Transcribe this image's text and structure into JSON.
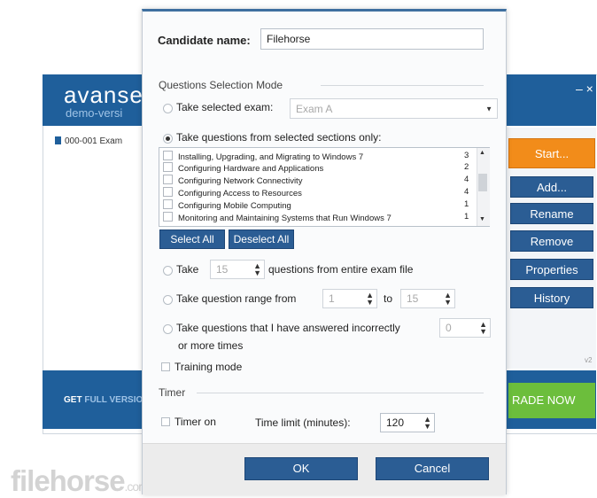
{
  "background_app": {
    "logo_text": "avanse",
    "logo_subtext": "demo-versi",
    "minimize_glyph": "– ×",
    "exam_list": [
      "000-001 Exam"
    ],
    "footer_text_a": "GET ",
    "footer_text_b": "FULL VERSIO",
    "side_buttons": {
      "start": "Start...",
      "add": "Add...",
      "rename": "Rename",
      "remove": "Remove",
      "properties": "Properties",
      "history": "History"
    },
    "upgrade_button": "RADE NOW",
    "version_hint": "v2",
    "accent_colors": {
      "banner": "#1f5f9b",
      "start": "#f28c1a",
      "upgrade": "#6cbe3c",
      "button": "#2b5d94"
    }
  },
  "watermark": {
    "text": "filehorse",
    "suffix": ".com"
  },
  "dialog": {
    "candidate_label": "Candidate name:",
    "candidate_value": "Filehorse",
    "questions_mode_title": "Questions Selection Mode",
    "opt_selected_exam": "Take selected exam:",
    "selected_exam_value": "Exam A",
    "opt_sections": "Take questions from selected sections only:",
    "sections": [
      {
        "name": "Installing, Upgrading, and Migrating to Windows 7",
        "count": "3"
      },
      {
        "name": "Configuring Hardware and Applications",
        "count": "2"
      },
      {
        "name": "Configuring Network Connectivity",
        "count": "4"
      },
      {
        "name": "Configuring Access to Resources",
        "count": "4"
      },
      {
        "name": "Configuring Mobile Computing",
        "count": "1"
      },
      {
        "name": "Monitoring and Maintaining Systems that Run Windows 7",
        "count": "1"
      }
    ],
    "select_all": "Select All",
    "deselect_all": "Deselect All",
    "opt_take": "Take",
    "take_value": "15",
    "take_suffix": "questions from entire exam file",
    "opt_range": "Take question range from",
    "range_from": "1",
    "range_to_label": "to",
    "range_to": "15",
    "opt_incorrect": "Take questions that I have answered incorrectly",
    "incorrect_value": "0",
    "incorrect_suffix": "or more times",
    "training_mode": "Training mode",
    "timer_title": "Timer",
    "timer_on": "Timer on",
    "time_limit_label": "Time limit (minutes):",
    "time_limit_value": "120",
    "ok": "OK",
    "cancel": "Cancel"
  }
}
